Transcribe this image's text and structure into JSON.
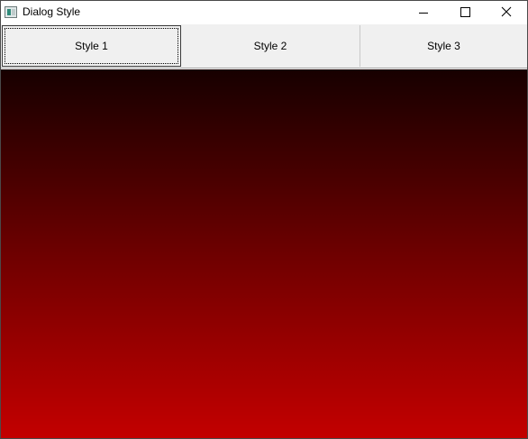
{
  "window": {
    "title": "Dialog Style",
    "controls": {
      "minimize": "minimize",
      "maximize": "maximize",
      "close": "close"
    }
  },
  "toolbar": {
    "buttons": [
      {
        "label": "Style 1",
        "focused": true
      },
      {
        "label": "Style 2",
        "focused": false
      },
      {
        "label": "Style 3",
        "focused": false
      }
    ]
  },
  "canvas": {
    "gradient_top_color": "#170000",
    "gradient_bottom_color": "#c30000"
  }
}
